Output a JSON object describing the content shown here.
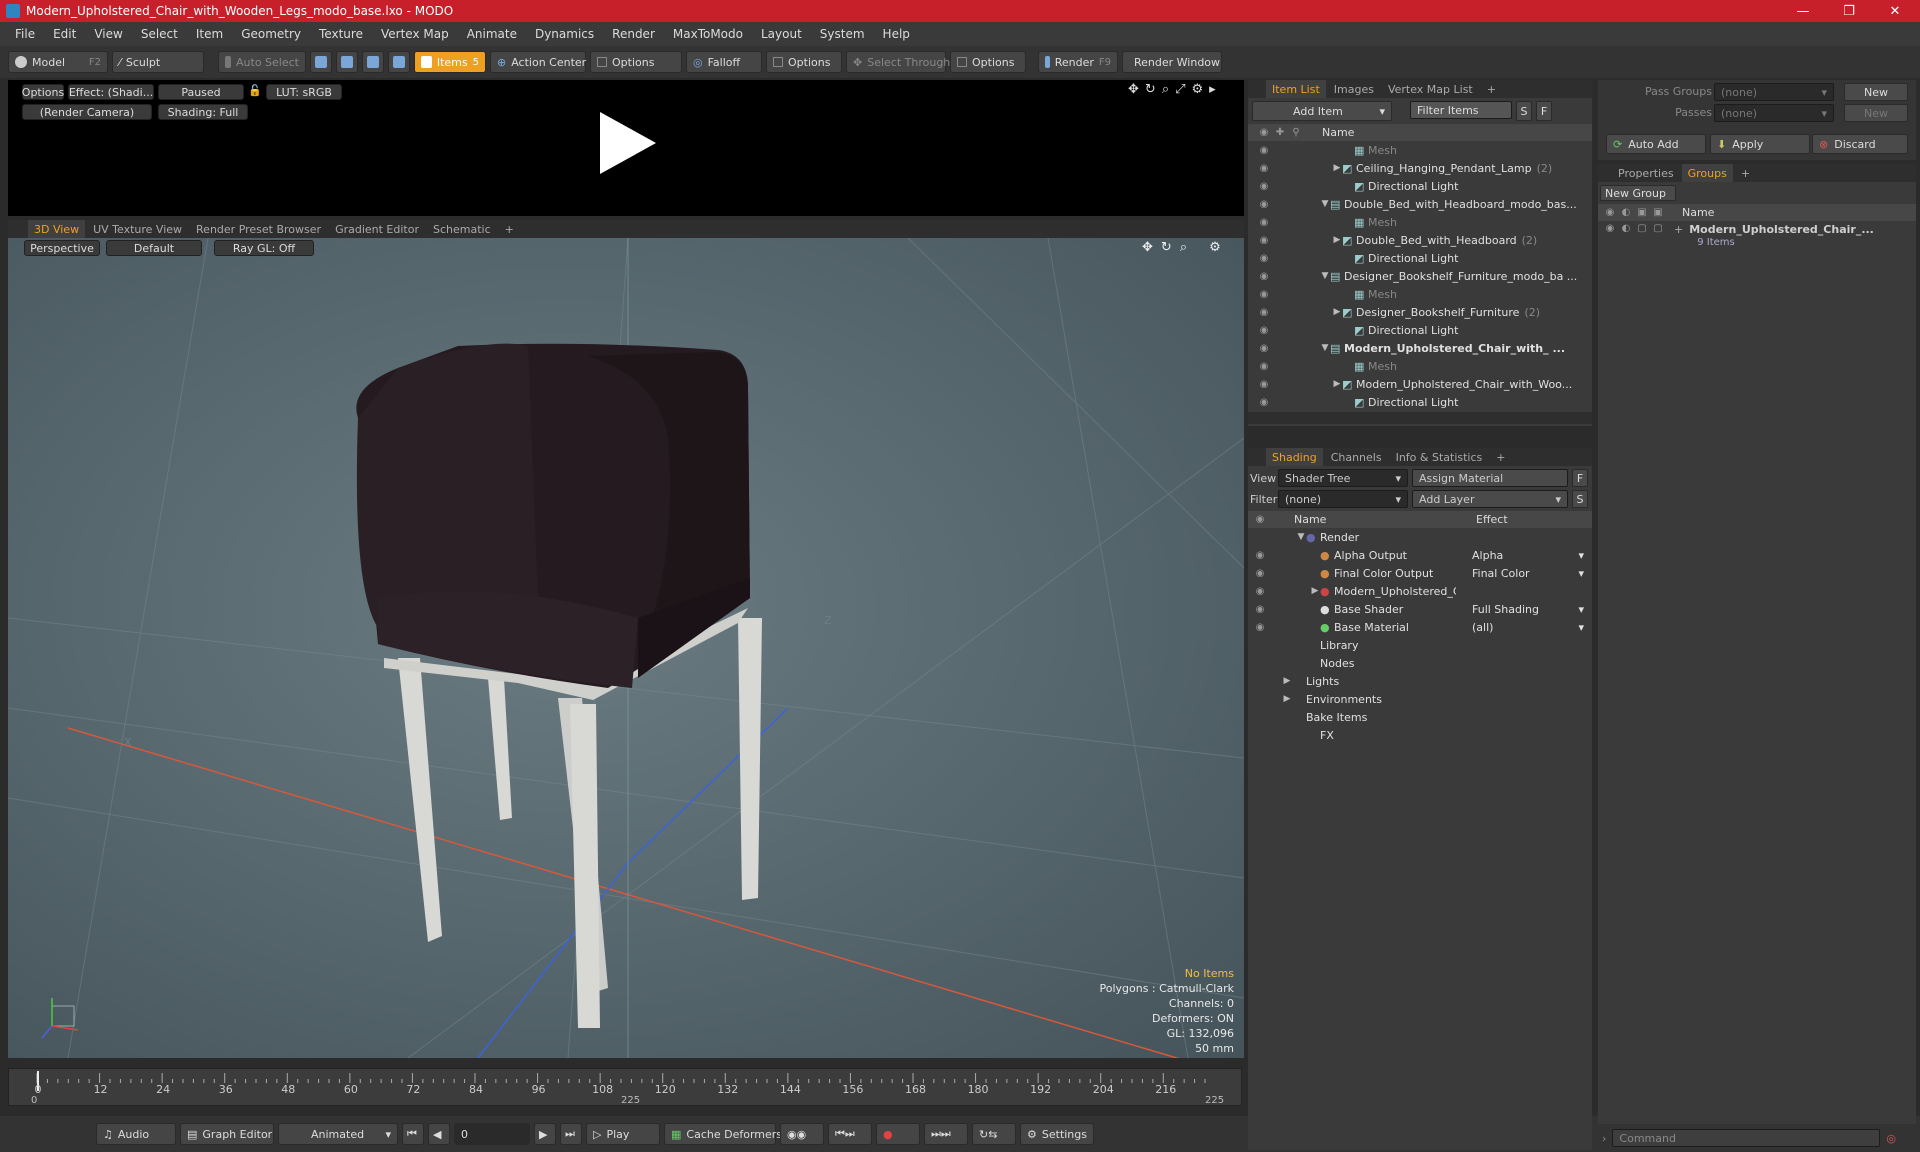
{
  "window": {
    "title": "Modern_Upholstered_Chair_with_Wooden_Legs_modo_base.lxo - MODO",
    "min": "—",
    "max": "❐",
    "close": "✕"
  },
  "menu": [
    "File",
    "Edit",
    "View",
    "Select",
    "Item",
    "Geometry",
    "Texture",
    "Vertex Map",
    "Animate",
    "Dynamics",
    "Render",
    "MaxToModo",
    "Layout",
    "System",
    "Help"
  ],
  "toolbar": {
    "model": "Model",
    "model_key": "F2",
    "sculpt": "Sculpt",
    "auto_select": "Auto Select",
    "items": "Items",
    "items_key": "5",
    "action_center": "Action Center",
    "options1": "Options",
    "falloff": "Falloff",
    "options2": "Options",
    "select_through": "Select Through",
    "options3": "Options",
    "render": "Render",
    "render_key": "F9",
    "render_window": "Render Window"
  },
  "preview": {
    "options": "Options",
    "effect": "Effect: (Shadi...",
    "paused": "Paused",
    "lut": "LUT: sRGB",
    "camera": "(Render Camera)",
    "shading": "Shading: Full"
  },
  "viewport_tabs": [
    "3D View",
    "UV Texture View",
    "Render Preset Browser",
    "Gradient Editor",
    "Schematic",
    "+"
  ],
  "viewport": {
    "perspective": "Perspective",
    "default": "Default",
    "raygl": "Ray GL: Off"
  },
  "hud": {
    "items": "No Items",
    "polygons": "Polygons : Catmull-Clark",
    "channels": "Channels: 0",
    "deformers": "Deformers: ON",
    "gl": "GL: 132,096",
    "mm": "50 mm"
  },
  "axis": {
    "x": "X",
    "z": "Z"
  },
  "item_tabs": [
    "Item List",
    "Images",
    "Vertex Map List",
    "+"
  ],
  "item_list": {
    "add_item": "Add Item",
    "filter": "Filter Items",
    "s": "S",
    "f": "F",
    "col_name": "Name",
    "rows": [
      {
        "label": "Mesh",
        "indent": 3,
        "dim": true,
        "tri": ""
      },
      {
        "label": "Ceiling_Hanging_Pendant_Lamp",
        "count": "(2)",
        "indent": 2,
        "tri": "▶"
      },
      {
        "label": "Directional Light",
        "indent": 3,
        "tri": ""
      },
      {
        "label": "Double_Bed_with_Headboard_modo_bas...",
        "indent": 1,
        "tri": "▼"
      },
      {
        "label": "Mesh",
        "indent": 3,
        "dim": true,
        "tri": ""
      },
      {
        "label": "Double_Bed_with_Headboard",
        "count": "(2)",
        "indent": 2,
        "tri": "▶"
      },
      {
        "label": "Directional Light",
        "indent": 3,
        "tri": ""
      },
      {
        "label": "Designer_Bookshelf_Furniture_modo_ba ...",
        "indent": 1,
        "tri": "▼"
      },
      {
        "label": "Mesh",
        "indent": 3,
        "dim": true,
        "tri": ""
      },
      {
        "label": "Designer_Bookshelf_Furniture",
        "count": "(2)",
        "indent": 2,
        "tri": "▶"
      },
      {
        "label": "Directional Light",
        "indent": 3,
        "tri": ""
      },
      {
        "label": "Modern_Upholstered_Chair_with_ ...",
        "indent": 1,
        "bold": true,
        "tri": "▼"
      },
      {
        "label": "Mesh",
        "indent": 3,
        "dim": true,
        "tri": ""
      },
      {
        "label": "Modern_Upholstered_Chair_with_Woo...",
        "indent": 2,
        "tri": "▶"
      },
      {
        "label": "Directional Light",
        "indent": 3,
        "tri": ""
      }
    ]
  },
  "shading_tabs": [
    "Shading",
    "Channels",
    "Info & Statistics",
    "+"
  ],
  "shading": {
    "view_label": "View",
    "view_value": "Shader Tree",
    "assign": "Assign Material",
    "f": "F",
    "filter_label": "Filter",
    "filter_value": "(none)",
    "add_layer": "Add Layer",
    "s": "S",
    "col_name": "Name",
    "col_effect": "Effect",
    "rows": [
      {
        "label": "Render",
        "effect": "",
        "indent": 0,
        "tri": "▼"
      },
      {
        "label": "Alpha Output",
        "effect": "Alpha",
        "indent": 1,
        "tri": ""
      },
      {
        "label": "Final Color Output",
        "effect": "Final Color",
        "indent": 1,
        "tri": ""
      },
      {
        "label": "Modern_Upholstered_Chair...",
        "effect": "",
        "indent": 1,
        "tri": "▶"
      },
      {
        "label": "Base Shader",
        "effect": "Full Shading",
        "indent": 1,
        "tri": ""
      },
      {
        "label": "Base Material",
        "effect": "(all)",
        "indent": 1,
        "tri": ""
      },
      {
        "label": "Library",
        "effect": "",
        "indent": 0,
        "tri": ""
      },
      {
        "label": "Nodes",
        "effect": "",
        "indent": 0,
        "tri": ""
      },
      {
        "label": "Lights",
        "effect": "",
        "indent": -1,
        "tri": "▶"
      },
      {
        "label": "Environments",
        "effect": "",
        "indent": -1,
        "tri": "▶"
      },
      {
        "label": "Bake Items",
        "effect": "",
        "indent": -1,
        "tri": ""
      },
      {
        "label": "FX",
        "effect": "",
        "indent": 0,
        "tri": ""
      }
    ]
  },
  "pass": {
    "groups_label": "Pass Groups",
    "groups_value": "(none)",
    "new1": "New",
    "passes_label": "Passes",
    "passes_value": "(none)",
    "new2": "New",
    "auto_add": "Auto Add",
    "apply": "Apply",
    "discard": "Discard"
  },
  "groups_tabs": [
    "Properties",
    "Groups",
    "+"
  ],
  "groups": {
    "new_group": "New Group",
    "col_name": "Name",
    "item": "Modern_Upholstered_Chair_...",
    "item_count": "9 Items"
  },
  "command": "Command",
  "timeline": {
    "ticks": [
      "0",
      "12",
      "24",
      "36",
      "48",
      "60",
      "72",
      "84",
      "96",
      "108",
      "120",
      "132",
      "144",
      "156",
      "168",
      "180",
      "192",
      "204",
      "216"
    ],
    "start": "0",
    "mid": "225",
    "end": "225"
  },
  "transport": {
    "audio": "Audio",
    "graph": "Graph Editor",
    "animated": "Animated",
    "frame": "0",
    "play": "Play",
    "cache": "Cache Deformers",
    "settings": "Settings"
  }
}
